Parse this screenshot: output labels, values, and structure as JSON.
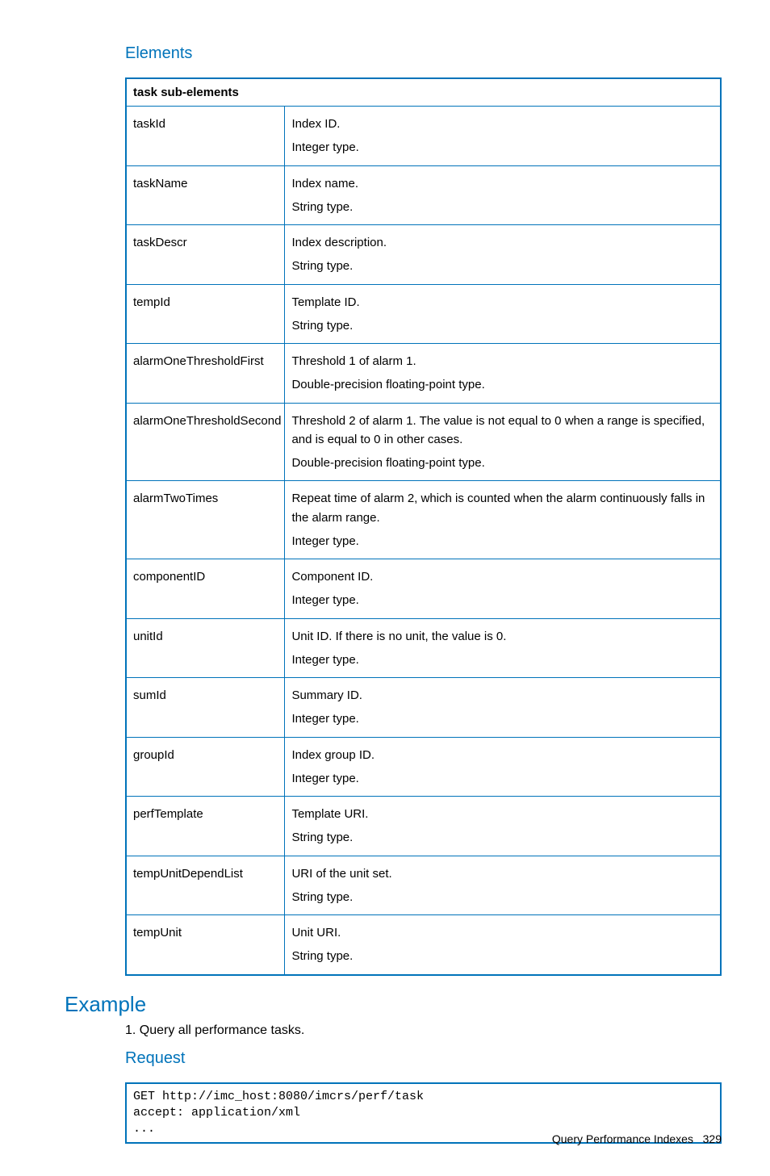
{
  "headings": {
    "elements": "Elements",
    "example": "Example",
    "request": "Request"
  },
  "table": {
    "header": "task sub-elements",
    "rows": [
      {
        "name": "taskId",
        "desc": [
          "Index ID.",
          "Integer type."
        ]
      },
      {
        "name": "taskName",
        "desc": [
          "Index name.",
          "String type."
        ]
      },
      {
        "name": "taskDescr",
        "desc": [
          "Index description.",
          "String type."
        ]
      },
      {
        "name": "tempId",
        "desc": [
          "Template ID.",
          "String type."
        ]
      },
      {
        "name": "alarmOneThresholdFirst",
        "desc": [
          "Threshold 1 of alarm 1.",
          "Double-precision floating-point type."
        ]
      },
      {
        "name": "alarmOneThresholdSecond",
        "desc": [
          "Threshold 2 of alarm 1. The value is not equal to 0 when a range is specified, and is equal to 0 in other cases.",
          "Double-precision floating-point type."
        ]
      },
      {
        "name": "alarmTwoTimes",
        "desc": [
          "Repeat time of alarm 2, which is counted when the alarm continuously falls in the alarm range.",
          "Integer type."
        ]
      },
      {
        "name": "componentID",
        "desc": [
          "Component ID.",
          "Integer type."
        ]
      },
      {
        "name": "unitId",
        "desc": [
          "Unit ID. If there is no unit, the value is 0.",
          "Integer type."
        ]
      },
      {
        "name": "sumId",
        "desc": [
          "Summary ID.",
          "Integer type."
        ]
      },
      {
        "name": "groupId",
        "desc": [
          "Index group ID.",
          "Integer type."
        ]
      },
      {
        "name": "perfTemplate",
        "desc": [
          "Template URI.",
          "String type."
        ]
      },
      {
        "name": "tempUnitDependList",
        "desc": [
          "URI of the unit set.",
          "String type."
        ]
      },
      {
        "name": "tempUnit",
        "desc": [
          "Unit URI.",
          "String type."
        ]
      }
    ]
  },
  "example": {
    "step1": "1. Query all performance tasks.",
    "code": "GET http://imc_host:8080/imcrs/perf/task\naccept: application/xml\n..."
  },
  "footer": {
    "title": "Query Performance Indexes",
    "page": "329"
  }
}
